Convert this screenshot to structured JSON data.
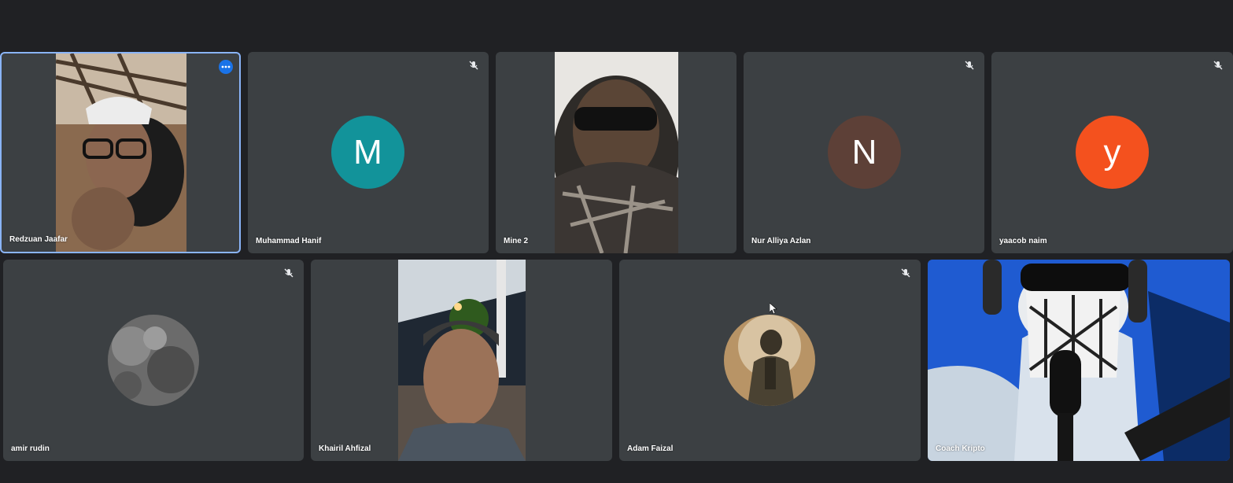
{
  "colors": {
    "background": "#202124",
    "tile": "#3c4043",
    "active_border": "#8ab4f8",
    "avatar_m": "#12939a",
    "avatar_n": "#5d4037",
    "avatar_y": "#f4511e"
  },
  "participants": [
    {
      "name": "Redzuan Jaafar",
      "type": "video",
      "muted": false,
      "active": true
    },
    {
      "name": "Muhammad Hanif",
      "type": "initial",
      "initial": "M",
      "muted": true
    },
    {
      "name": "Mine 2",
      "type": "video",
      "muted": false
    },
    {
      "name": "Nur Alliya Azlan",
      "type": "initial",
      "initial": "N",
      "muted": true
    },
    {
      "name": "yaacob naim",
      "type": "initial",
      "initial": "y",
      "muted": true
    },
    {
      "name": "amir rudin",
      "type": "photo-avatar",
      "muted": true
    },
    {
      "name": "Khairil Ahfizal",
      "type": "video",
      "muted": false
    },
    {
      "name": "Adam Faizal",
      "type": "photo-avatar",
      "muted": true
    },
    {
      "name": "Coach Kripto",
      "type": "video",
      "muted": false
    }
  ],
  "icons": {
    "mute": "mic-off-icon",
    "more": "more-options-icon"
  }
}
